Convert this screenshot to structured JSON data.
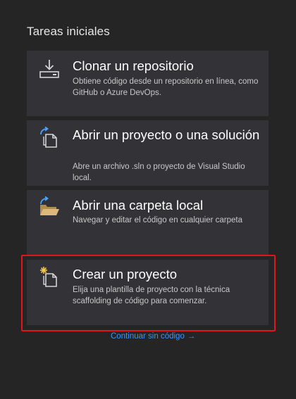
{
  "section": {
    "title": "Tareas iniciales"
  },
  "cards": [
    {
      "icon": "clone-download-icon",
      "title": "Clonar un repositorio",
      "description": "Obtiene código desde un repositorio en línea, como GitHub o Azure DevOps."
    },
    {
      "icon": "open-project-icon",
      "title": "Abrir un proyecto o una solución",
      "description": "Abre un archivo .sln o proyecto de Visual Studio local."
    },
    {
      "icon": "open-folder-icon",
      "title": "Abrir una carpeta local",
      "description": "Navegar y editar el código en cualquier carpeta"
    },
    {
      "icon": "new-project-icon",
      "title": "Crear un proyecto",
      "description": "Elija una plantilla de proyecto con la técnica scaffolding de código para comenzar."
    }
  ],
  "footer": {
    "continue_label": "Continuar sin código",
    "continue_arrow": "→"
  },
  "colors": {
    "background": "#252526",
    "card": "#333337",
    "link": "#3794ff",
    "highlight": "#e3141b",
    "folder": "#dcb67a"
  }
}
